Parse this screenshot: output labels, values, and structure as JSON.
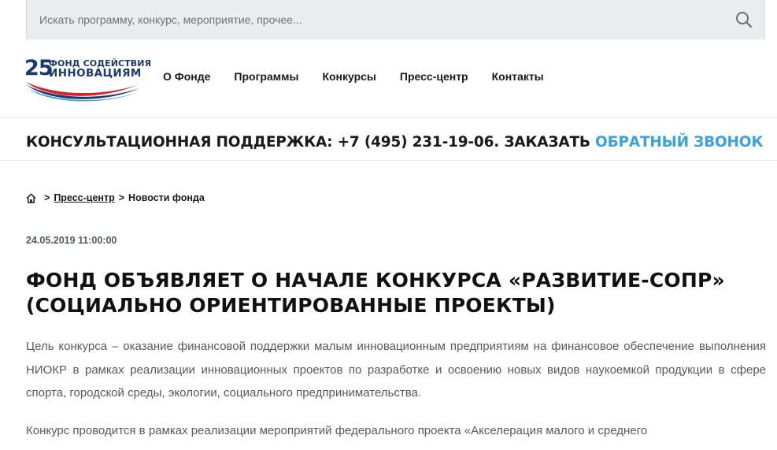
{
  "search": {
    "placeholder": "Искать программу, конкурс, мероприятие, прочее..."
  },
  "logo": {
    "number": "25",
    "line1": "ФОНД СОДЕЙСТВИЯ",
    "line2": "ИННОВАЦИЯМ",
    "colors": {
      "blue": "#1b3a6b",
      "red": "#d8232a",
      "light_blue": "#3da2d9"
    }
  },
  "nav": {
    "items": [
      "О Фонде",
      "Программы",
      "Конкурсы",
      "Пресс-центр",
      "Контакты"
    ]
  },
  "consult": {
    "text": "КОНСУЛЬТАЦИОННАЯ ПОДДЕРЖКА: +7 (495) 231-19-06. ЗАКАЗАТЬ ",
    "link": "ОБРАТНЫЙ ЗВОНОК",
    "link_color": "#3da2d9"
  },
  "breadcrumb": {
    "home_icon": "home-icon",
    "separator": ">",
    "items": [
      "Пресс-центр",
      "Новости фонда"
    ]
  },
  "article": {
    "date": "24.05.2019 11:00:00",
    "title": "ФОНД ОБЪЯВЛЯЕТ О НАЧАЛЕ КОНКУРСА «РАЗВИТИЕ-СОПР» (СОЦИАЛЬНО ОРИЕНТИРОВАННЫЕ ПРОЕКТЫ)",
    "paragraphs": [
      "Цель конкурса – оказание финансовой поддержки малым инновационным предприятиям на финансовое обеспечение выполнения НИОКР в рамках реализации инновационных проектов по разработке и освоению новых видов наукоемкой продукции в сфере спорта, городской среды, экологии, социального предпринимательства.",
      "Конкурс проводится в рамках реализации мероприятий федерального проекта «Акселерация малого и среднего"
    ]
  }
}
